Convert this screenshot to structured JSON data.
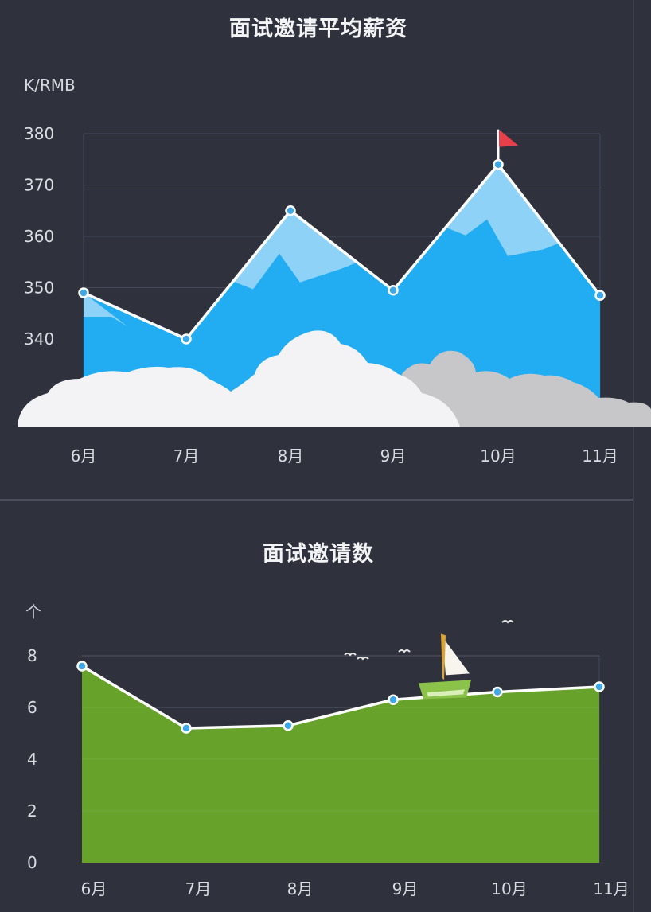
{
  "charts": [
    {
      "title": "面试邀请平均薪资",
      "unit": "K/RMB",
      "chart_data": {
        "type": "area",
        "title": "面试邀请平均薪资",
        "ylabel": "K/RMB",
        "categories": [
          "6月",
          "7月",
          "8月",
          "9月",
          "10月",
          "11月"
        ],
        "series": [
          {
            "values": [
              349,
              340,
              365,
              349.5,
              374,
              348.5
            ]
          }
        ],
        "y_ticks": [
          340,
          350,
          360,
          370,
          380
        ],
        "ylim": [
          320,
          380
        ],
        "grid": true,
        "colors": {
          "area": "#22adf2",
          "peak": "#8fd2f7",
          "line": "#ffffff",
          "flag": "#e8404a"
        }
      }
    },
    {
      "title": "面试邀请数",
      "unit": "个",
      "chart_data": {
        "type": "area",
        "title": "面试邀请数",
        "ylabel": "个",
        "categories": [
          "6月",
          "7月",
          "8月",
          "9月",
          "10月",
          "11月"
        ],
        "series": [
          {
            "values": [
              7.6,
              5.2,
              5.3,
              6.3,
              6.6,
              6.8
            ]
          }
        ],
        "y_ticks": [
          0,
          2,
          4,
          6,
          8
        ],
        "ylim": [
          0,
          8
        ],
        "grid": true,
        "colors": {
          "area": "#67a22a",
          "line": "#ffffff",
          "boat": "#8bc34a"
        }
      }
    }
  ]
}
